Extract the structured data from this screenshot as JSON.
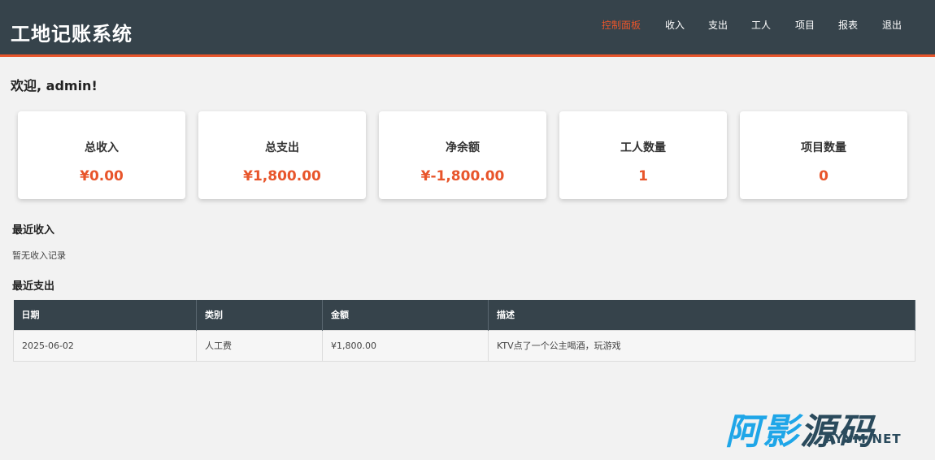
{
  "app": {
    "title": "工地记账系统"
  },
  "nav": {
    "items": [
      {
        "label": "控制面板",
        "active": true
      },
      {
        "label": "收入"
      },
      {
        "label": "支出"
      },
      {
        "label": "工人"
      },
      {
        "label": "项目"
      },
      {
        "label": "报表"
      },
      {
        "label": "退出"
      }
    ]
  },
  "welcome": "欢迎, admin!",
  "cards": [
    {
      "title": "总收入",
      "value": "¥0.00"
    },
    {
      "title": "总支出",
      "value": "¥1,800.00"
    },
    {
      "title": "净余额",
      "value": "¥-1,800.00"
    },
    {
      "title": "工人数量",
      "value": "1"
    },
    {
      "title": "项目数量",
      "value": "0"
    }
  ],
  "recent_income": {
    "title": "最近收入",
    "empty_text": "暂无收入记录"
  },
  "recent_expense": {
    "title": "最近支出",
    "headers": [
      "日期",
      "类别",
      "金额",
      "描述"
    ],
    "rows": [
      [
        "2025-06-02",
        "人工费",
        "¥1,800.00",
        "KTV点了一个公主喝酒，玩游戏"
      ]
    ]
  },
  "watermark": {
    "big_blue": "阿影",
    "big_dark": "源码",
    "small": "AYYM.NET"
  },
  "colors": {
    "header_bg": "#36434b",
    "accent": "#e8552b",
    "page_bg": "#f2f2f2",
    "watermark_blue": "#1fa6e8"
  }
}
